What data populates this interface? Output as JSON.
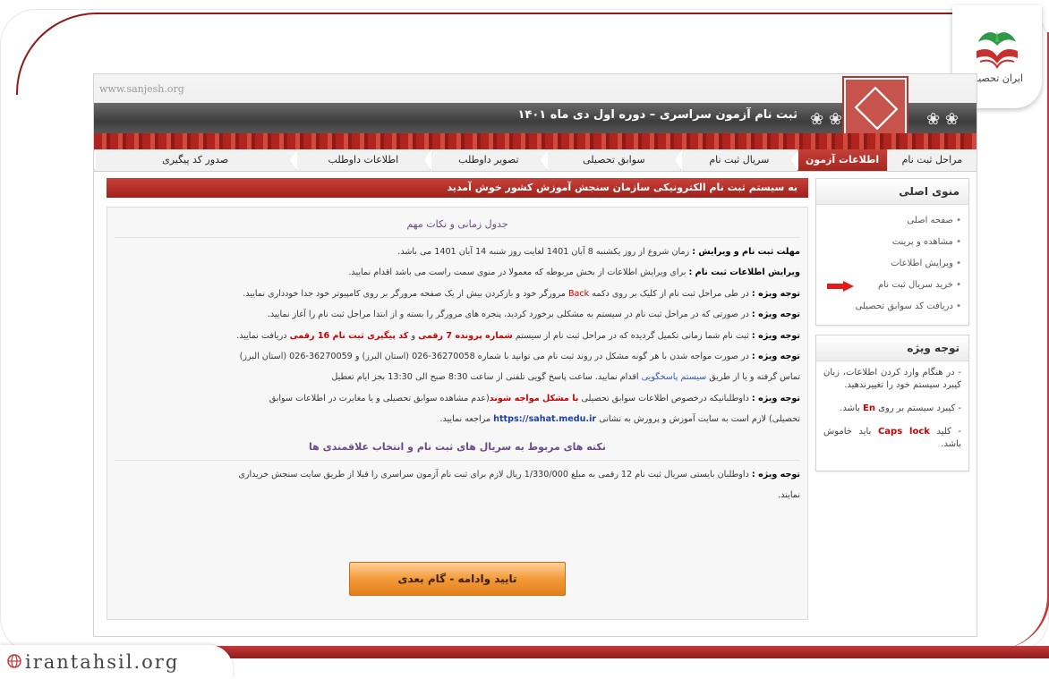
{
  "watermark": {
    "brand_name": "ایران تحصیل",
    "domain": "irantahsil.org"
  },
  "banner": {
    "site": "www.sanjesh.org",
    "title": "ثبت نام آزمون سراسری – دوره اول دی ماه ۱۴۰۱"
  },
  "tabs": [
    {
      "label": "مراحل ثبت نام",
      "active": false
    },
    {
      "label": "اطلاعات آزمون",
      "active": true
    },
    {
      "label": "سریال ثبت نام",
      "active": false
    },
    {
      "label": "سوابق تحصیلی",
      "active": false
    },
    {
      "label": "تصویر داوطلب",
      "active": false
    },
    {
      "label": "اطلاعات داوطلب",
      "active": false
    },
    {
      "label": "صدور کد پیگیری",
      "active": false
    }
  ],
  "sidebar": {
    "menu_title": "منوی اصلی",
    "items": [
      "صفحه اصلی",
      "مشاهده و پرینت",
      "ویرایش اطلاعات",
      "خرید سریال ثبت نام",
      "دریافت کد سوابق تحصیلی"
    ],
    "notes_title": "توجه ویژه",
    "notes": [
      {
        "pre": "- در هنگام وارد کردن اطلاعات، زبان کیبرد سیستم خود را تغییرندهید.",
        "key": "",
        "post": ""
      },
      {
        "pre": "- کیبرد سیستم بر روی ",
        "key": "En",
        "post": " باشد."
      },
      {
        "pre": "- کلید ",
        "key": "Caps lock",
        "post": " باید خاموش باشد."
      }
    ]
  },
  "main": {
    "welcome": "به سیستم ثبت نام الکترونیکی سازمان سنجش آموزش کشور خوش آمدید",
    "section1_title": "جدول زمانی و نکات مهم",
    "lines": [
      {
        "b": "مهلت ثبت نام و ویرایش :",
        "t": " زمان شروع از روز یکشنبه 8 آبان 1401 لغایت روز شنبه 14 آبان 1401 می باشد."
      },
      {
        "b": "ویرایش اطلاعات ثبت نام :",
        "t": " برای ویرایش اطلاعات از بخش مربوطه که معمولا در منوی سمت راست می باشد اقدام نمایید."
      },
      {
        "b": "توجه ویژه :",
        "t": " در طی مراحل ثبت نام از کلیک بر روی دکمه ",
        "back": "Back",
        "t2": " مرورگر خود و بازکردن بیش از یک صفحه مرورگر بر روی کامپیوتر خود جدا خودداری نمایید."
      },
      {
        "b": "توجه ویژه :",
        "t": " در صورتی که در مراحل ثبت نام در سیستم به مشکلی برخورد کردید، پنجره های مرورگر را بسته و از ابتدا مراحل ثبت نام را آغاز نمایید."
      },
      {
        "b": "توجه ویژه :",
        "t": " ثبت نام شما زمانی تکمیل گردیده که در مراحل ثبت نام از سیستم ",
        "red": "شماره پرونده 7 رقمی",
        "t2": " و ",
        "red2": "کد پیگیری ثبت نام 16 رقمی",
        "t3": " دریافت نمایید."
      },
      {
        "b": "توجه ویژه :",
        "t": " در صورت مواجه شدن با هر گونه مشکل در روند ثبت نام می توانید با شماره 36270058-026 (استان البرز) و 36270059-026 (استان البرز)"
      },
      {
        "b": "",
        "t": "تماس گرفته و یا از طریق ",
        "link": "سیستم پاسخگویی",
        "t2": " اقدام نمایید. ساعت پاسخ گویی تلفنی از ساعت 8:30 صبح الی 13:30 بجز ایام تعطیل"
      },
      {
        "b": "توجه ویژه :",
        "t": " داوطلبانیکه درخصوص اطلاعات سوابق تحصیلی ",
        "red": "با مشکل مواجه شوند",
        "t2": "(عدم مشاهده سوابق تحصیلی و یا مغایرت در اطلاعات سوابق"
      },
      {
        "b": "",
        "t": "تحصیلی) لازم است به سایت آموزش و پرورش به نشانی ",
        "url": "https://sahat.medu.ir",
        "t2": " مراجعه نمایید."
      }
    ],
    "section2_title": "نکته های مربوط به سریال های ثبت نام و انتخاب علاقمندی ها",
    "lines2": [
      {
        "b": "توجه ویژه :",
        "t": " داوطلبان بایستی سریال ثبت نام 12 رقمی به مبلغ 1/330/000 ریال لازم برای ثبت نام آزمون سراسری را قبلا از طریق سایت سنجش خریداری"
      },
      {
        "b": "",
        "t": "نمایند."
      }
    ],
    "confirm_button": "تایید وادامه - گام بعدی"
  },
  "colors": {
    "brand_red": "#a42620",
    "confirm_orange": "#f39a3a",
    "alert_red": "#cc0000"
  }
}
